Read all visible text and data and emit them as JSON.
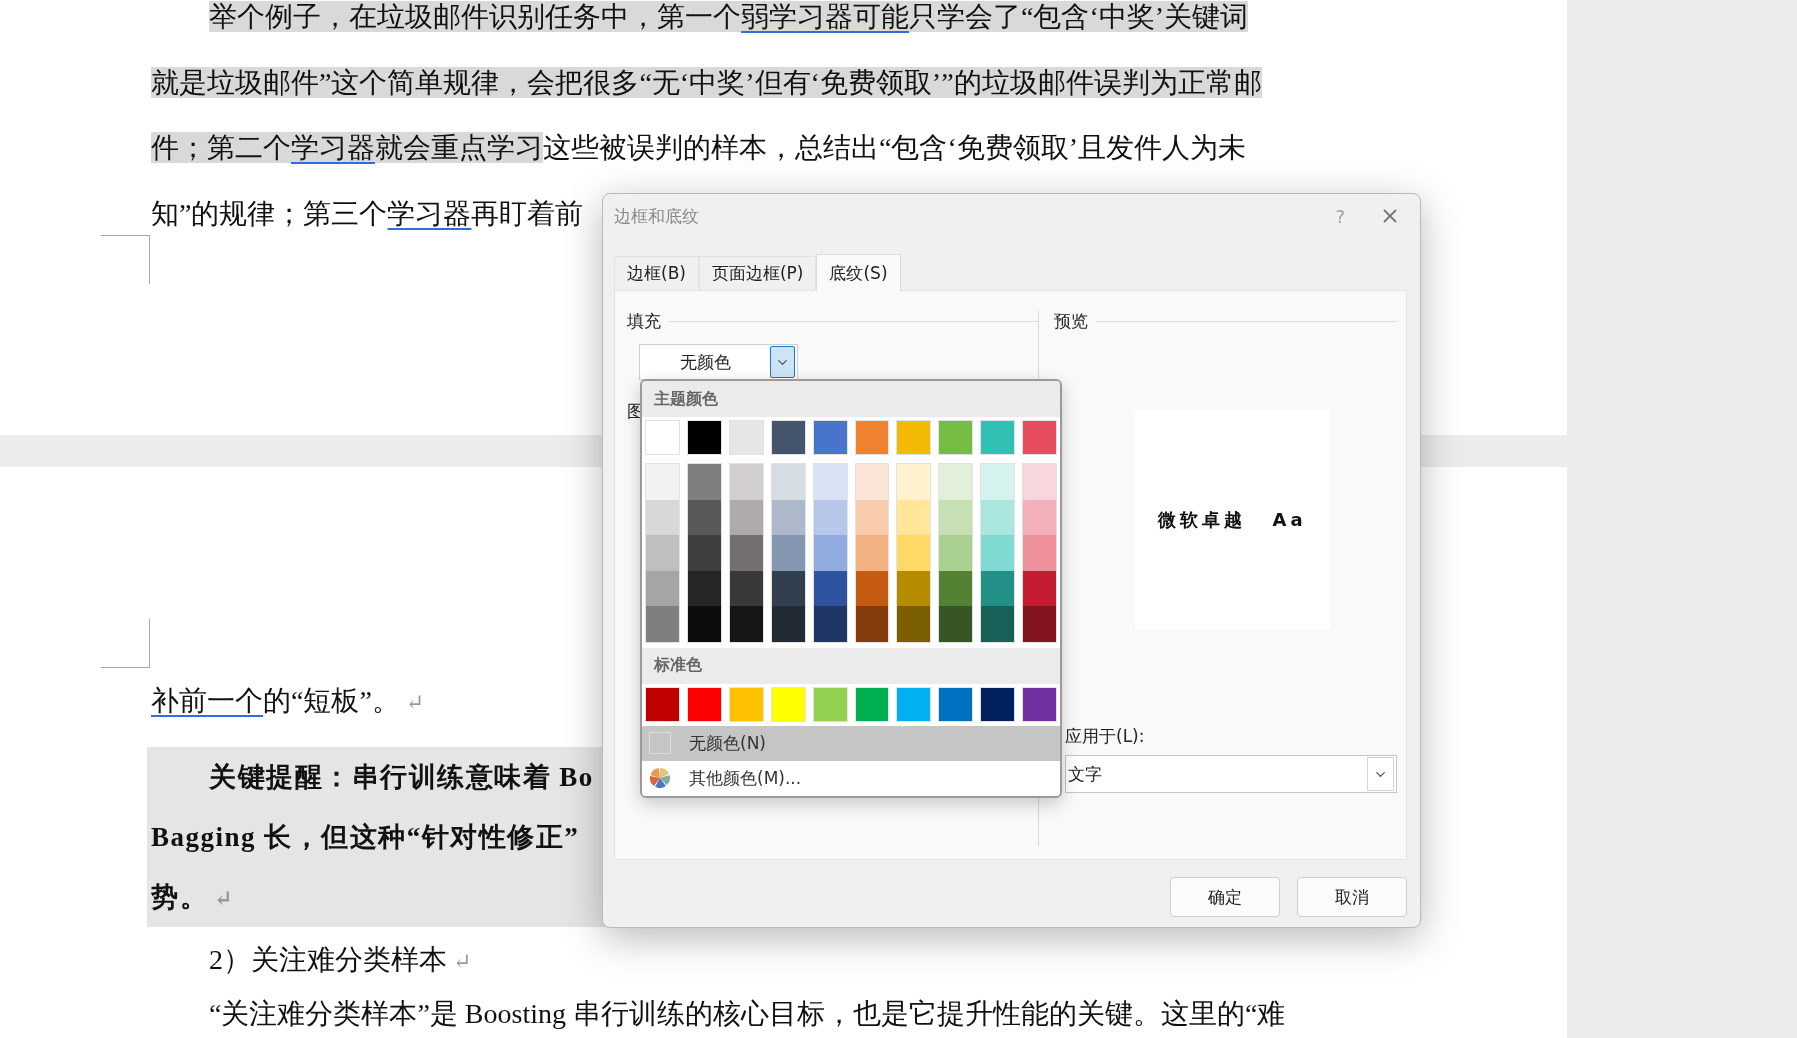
{
  "page_1": {
    "paragraph_lines": [
      {
        "segments": [
          {
            "text": "举个例子，在垃圾邮件识别任务中，第一个",
            "highlight": true,
            "underline": false
          },
          {
            "text": "弱学习器可能",
            "highlight": true,
            "underline": true
          },
          {
            "text": "只学会了“包含‘中奖’关键词",
            "highlight": true,
            "underline": false
          }
        ]
      },
      {
        "segments": [
          {
            "text": "就是垃圾邮件”这个简单规律，会把很多“无‘中奖’但有‘免费领取’”的垃圾邮件误判为正常邮",
            "highlight": true,
            "underline": false
          }
        ]
      },
      {
        "segments": [
          {
            "text": "件；第二个",
            "highlight": true,
            "underline": false
          },
          {
            "text": "学习器",
            "highlight": true,
            "underline": true
          },
          {
            "text": "就会重点学习",
            "highlight": true,
            "underline": false
          },
          {
            "text": "这些被误判的样本，总结出“包含‘免费领取’且发件人为未",
            "highlight": false,
            "underline": false
          }
        ]
      },
      {
        "segments": [
          {
            "text": "知”的规律；第三个",
            "highlight": false,
            "underline": false
          },
          {
            "text": "学习器",
            "highlight": false,
            "underline": true
          },
          {
            "text": "再盯着前",
            "highlight": false,
            "underline": false
          }
        ]
      }
    ]
  },
  "page_2": {
    "blocks": [
      {
        "kind": "continuation",
        "segments": [
          {
            "text": "补前一个",
            "highlight": false,
            "underline": true
          },
          {
            "text": "的“短板”。",
            "highlight": false,
            "underline": false
          }
        ],
        "mark": "↵"
      },
      {
        "kind": "callout",
        "lines": [
          {
            "segments": [
              {
                "text": "关键提醒：串行训练意味着 Bo",
                "highlight": false,
                "underline": false
              }
            ]
          },
          {
            "segments": [
              {
                "text": "Bagging 长，但这种“针对性修正”",
                "highlight": false,
                "underline": false
              }
            ]
          },
          {
            "segments": [
              {
                "text": "势。",
                "highlight": false,
                "underline": false
              }
            ],
            "mark": "↵"
          }
        ]
      },
      {
        "kind": "paragraph",
        "segments": [
          {
            "text": "2）关注难分类样本",
            "highlight": false,
            "underline": false
          }
        ],
        "mark": "↵"
      },
      {
        "kind": "paragraph",
        "segments": [
          {
            "text": "“关注难分类样本”是 Boosting 串行训练的核心目标，也是它提升性能的关键。这里的“难",
            "highlight": false,
            "underline": false
          }
        ]
      }
    ]
  },
  "dialog": {
    "title": "边框和底纹",
    "help": "?",
    "tabs": [
      {
        "label": "边框(B)",
        "selected": false
      },
      {
        "label": "页面边框(P)",
        "selected": false
      },
      {
        "label": "底纹(S)",
        "selected": true
      }
    ],
    "fill": {
      "label": "填充",
      "value": "无颜色"
    },
    "pattern_label": "图",
    "preview": {
      "label": "预览",
      "sample_texts": [
        "微软卓越",
        "Aa"
      ]
    },
    "apply_to": {
      "label": "应用于(L):",
      "value": "文字"
    },
    "buttons": [
      "确定",
      "取消"
    ],
    "color_menu": {
      "theme_header": "主题颜色",
      "theme_columns": [
        {
          "color": "#ffffff",
          "shades": [
            {
              "color": "#f2f2f2"
            },
            {
              "color": "#d8d8d8"
            },
            {
              "color": "#bfbfbf"
            },
            {
              "color": "#a5a5a5"
            },
            {
              "color": "#7f7f7f"
            }
          ]
        },
        {
          "color": "#000000",
          "shades": [
            {
              "color": "#7f7f7f"
            },
            {
              "color": "#595959"
            },
            {
              "color": "#3f3f3f"
            },
            {
              "color": "#262626"
            },
            {
              "color": "#0d0d0d"
            }
          ]
        },
        {
          "color": "#e7e6e6",
          "shades": [
            {
              "color": "#d0cece"
            },
            {
              "color": "#aeaaaa"
            },
            {
              "color": "#757070"
            },
            {
              "color": "#3a3838"
            },
            {
              "color": "#171616"
            }
          ]
        },
        {
          "color": "#44546a",
          "shades": [
            {
              "color": "#d6dce4"
            },
            {
              "color": "#adb9ca"
            },
            {
              "color": "#8496b0"
            },
            {
              "color": "#323f4f"
            },
            {
              "color": "#222a35"
            }
          ]
        },
        {
          "color": "#4874cb",
          "shades": [
            {
              "color": "#dae3f3"
            },
            {
              "color": "#b6c7ea"
            },
            {
              "color": "#91acdf"
            },
            {
              "color": "#2e54a1"
            },
            {
              "color": "#1e3764"
            }
          ]
        },
        {
          "color": "#ee822f",
          "shades": [
            {
              "color": "#fbe5d6"
            },
            {
              "color": "#f8cbad"
            },
            {
              "color": "#f4b183"
            },
            {
              "color": "#c55a11"
            },
            {
              "color": "#843c0c"
            }
          ]
        },
        {
          "color": "#f2ba02",
          "shades": [
            {
              "color": "#fff2cc"
            },
            {
              "color": "#ffe699"
            },
            {
              "color": "#fed966"
            },
            {
              "color": "#b58b00"
            },
            {
              "color": "#7a5e00"
            }
          ]
        },
        {
          "color": "#75bd42",
          "shades": [
            {
              "color": "#e2efda"
            },
            {
              "color": "#c6e0b4"
            },
            {
              "color": "#a9d08e"
            },
            {
              "color": "#548235"
            },
            {
              "color": "#375623"
            }
          ]
        },
        {
          "color": "#30c0b4",
          "shades": [
            {
              "color": "#d5f2ef"
            },
            {
              "color": "#abe6df"
            },
            {
              "color": "#7fdbd2"
            },
            {
              "color": "#229086"
            },
            {
              "color": "#176159"
            }
          ]
        },
        {
          "color": "#e54c5e",
          "shades": [
            {
              "color": "#f8d7dc"
            },
            {
              "color": "#f3b0ba"
            },
            {
              "color": "#ee8f9c"
            },
            {
              "color": "#c31c33"
            },
            {
              "color": "#851421"
            }
          ]
        }
      ],
      "standard_header": "标准色",
      "standard_colors": [
        {
          "color": "#c00000"
        },
        {
          "color": "#ff0000"
        },
        {
          "color": "#ffc000"
        },
        {
          "color": "#ffff00"
        },
        {
          "color": "#92d050"
        },
        {
          "color": "#00b050"
        },
        {
          "color": "#00b0f0"
        },
        {
          "color": "#0070c0"
        },
        {
          "color": "#002060"
        },
        {
          "color": "#7030a0"
        }
      ],
      "items": [
        {
          "kind": "none",
          "label": "无颜色(N)",
          "selected": true
        },
        {
          "kind": "more",
          "label": "其他颜色(M)...",
          "selected": false
        }
      ]
    }
  }
}
